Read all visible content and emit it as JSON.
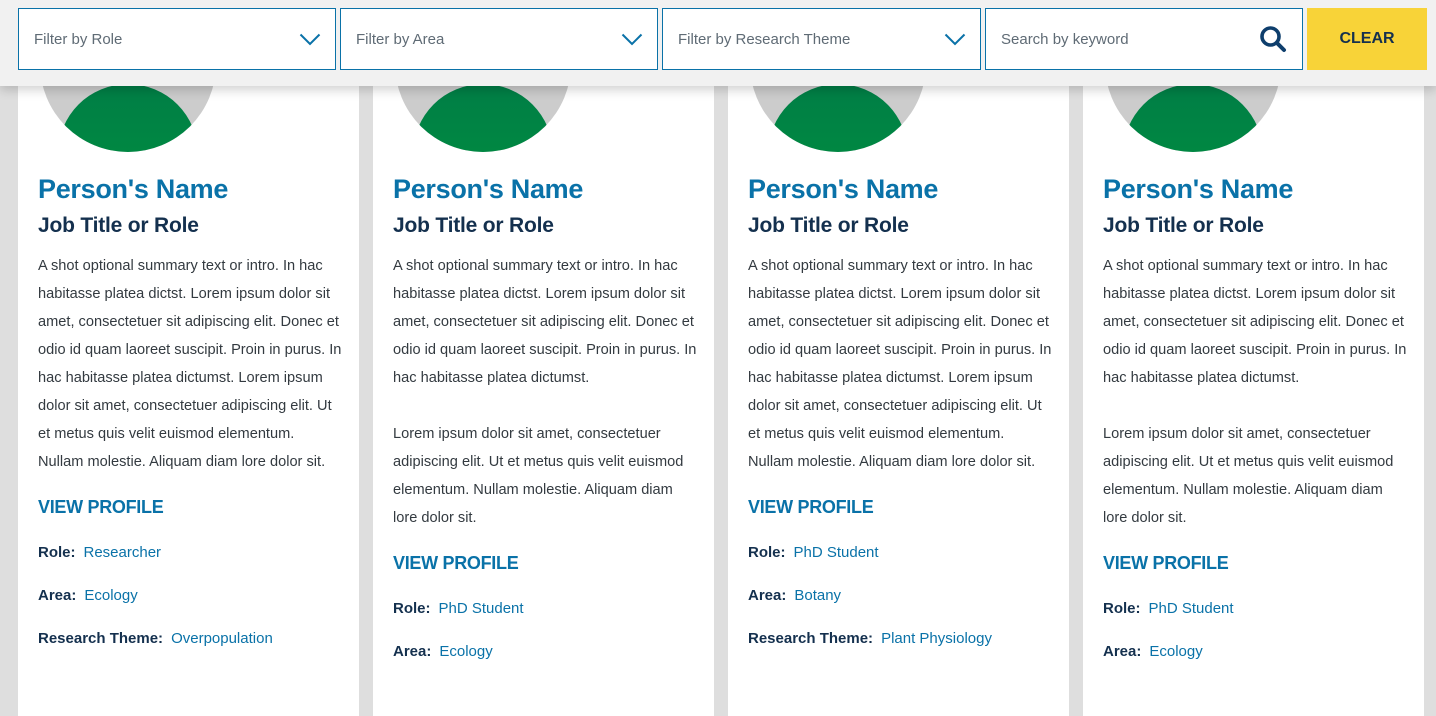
{
  "filters": {
    "role": {
      "placeholder": "Filter by Role",
      "icon": "chevron-down-icon"
    },
    "area": {
      "placeholder": "Filter by Area",
      "icon": "chevron-down-icon"
    },
    "theme": {
      "placeholder": "Filter by Research Theme",
      "icon": "chevron-down-icon"
    },
    "search": {
      "placeholder": "Search by keyword",
      "value": "",
      "icon": "search-icon"
    },
    "clear_label": "CLEAR"
  },
  "colors": {
    "accent_blue": "#0a72a8",
    "navy": "#14304e",
    "clear_yellow": "#f8d338",
    "avatar_green": "#00913e"
  },
  "people": [
    {
      "name": "Person's Name",
      "job_title": "Job Title or Role",
      "summary": [
        "A shot optional summary text or intro. In hac habitasse platea dictst. Lorem ipsum dolor sit amet, consectetuer sit adipiscing elit. Donec et odio id quam laoreet suscipit. Proin in purus. In hac habitasse platea dictumst. Lorem ipsum dolor sit amet, consectetuer adipiscing elit. Ut et metus quis velit euismod elementum. Nullam molestie. Aliquam diam lore dolor sit."
      ],
      "view_profile": "VIEW PROFILE",
      "meta": [
        {
          "label": "Role:",
          "value": "Researcher"
        },
        {
          "label": "Area:",
          "value": "Ecology"
        },
        {
          "label": "Research Theme:",
          "value": "Overpopulation"
        }
      ]
    },
    {
      "name": "Person's Name",
      "job_title": "Job Title or Role",
      "summary": [
        "A shot optional summary text or intro. In hac habitasse platea dictst. Lorem ipsum dolor sit amet, consectetuer sit adipiscing elit. Donec et odio id quam laoreet suscipit. Proin in purus. In hac habitasse platea dictumst.",
        "Lorem ipsum dolor sit amet, consectetuer adipiscing elit. Ut et metus quis velit euismod elementum. Nullam molestie. Aliquam diam lore dolor sit."
      ],
      "view_profile": "VIEW PROFILE",
      "meta": [
        {
          "label": "Role:",
          "value": "PhD Student"
        },
        {
          "label": "Area:",
          "value": "Ecology"
        }
      ]
    },
    {
      "name": "Person's Name",
      "job_title": "Job Title or Role",
      "summary": [
        "A shot optional summary text or intro. In hac habitasse platea dictst. Lorem ipsum dolor sit amet, consectetuer sit adipiscing elit. Donec et odio id quam laoreet suscipit. Proin in purus. In hac habitasse platea dictumst. Lorem ipsum dolor sit amet, consectetuer adipiscing elit. Ut et metus quis velit euismod elementum. Nullam molestie. Aliquam diam lore dolor sit."
      ],
      "view_profile": "VIEW PROFILE",
      "meta": [
        {
          "label": "Role:",
          "value": "PhD Student"
        },
        {
          "label": "Area:",
          "value": "Botany"
        },
        {
          "label": "Research Theme:",
          "value": "Plant Physiology"
        }
      ]
    },
    {
      "name": "Person's Name",
      "job_title": "Job Title or Role",
      "summary": [
        "A shot optional summary text or intro. In hac habitasse platea dictst. Lorem ipsum dolor sit amet, consectetuer sit adipiscing elit. Donec et odio id quam laoreet suscipit. Proin in purus. In hac habitasse platea dictumst.",
        "Lorem ipsum dolor sit amet, consectetuer adipiscing elit. Ut et metus quis velit euismod elementum. Nullam molestie. Aliquam diam lore dolor sit."
      ],
      "view_profile": "VIEW PROFILE",
      "meta": [
        {
          "label": "Role:",
          "value": "PhD Student"
        },
        {
          "label": "Area:",
          "value": "Ecology"
        }
      ]
    }
  ]
}
